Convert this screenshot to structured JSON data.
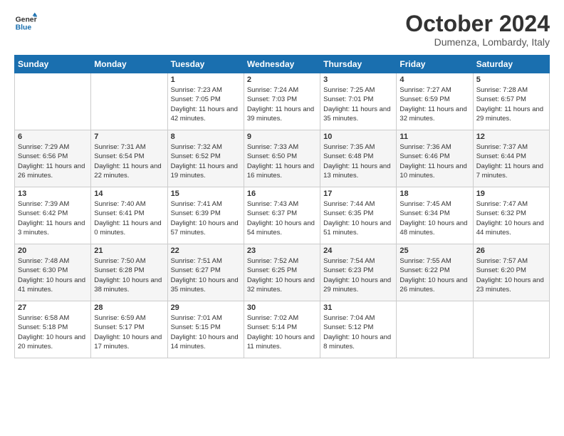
{
  "logo": {
    "line1": "General",
    "line2": "Blue"
  },
  "title": "October 2024",
  "subtitle": "Dumenza, Lombardy, Italy",
  "days_of_week": [
    "Sunday",
    "Monday",
    "Tuesday",
    "Wednesday",
    "Thursday",
    "Friday",
    "Saturday"
  ],
  "weeks": [
    [
      {
        "day": "",
        "info": ""
      },
      {
        "day": "",
        "info": ""
      },
      {
        "day": "1",
        "info": "Sunrise: 7:23 AM\nSunset: 7:05 PM\nDaylight: 11 hours and 42 minutes."
      },
      {
        "day": "2",
        "info": "Sunrise: 7:24 AM\nSunset: 7:03 PM\nDaylight: 11 hours and 39 minutes."
      },
      {
        "day": "3",
        "info": "Sunrise: 7:25 AM\nSunset: 7:01 PM\nDaylight: 11 hours and 35 minutes."
      },
      {
        "day": "4",
        "info": "Sunrise: 7:27 AM\nSunset: 6:59 PM\nDaylight: 11 hours and 32 minutes."
      },
      {
        "day": "5",
        "info": "Sunrise: 7:28 AM\nSunset: 6:57 PM\nDaylight: 11 hours and 29 minutes."
      }
    ],
    [
      {
        "day": "6",
        "info": "Sunrise: 7:29 AM\nSunset: 6:56 PM\nDaylight: 11 hours and 26 minutes."
      },
      {
        "day": "7",
        "info": "Sunrise: 7:31 AM\nSunset: 6:54 PM\nDaylight: 11 hours and 22 minutes."
      },
      {
        "day": "8",
        "info": "Sunrise: 7:32 AM\nSunset: 6:52 PM\nDaylight: 11 hours and 19 minutes."
      },
      {
        "day": "9",
        "info": "Sunrise: 7:33 AM\nSunset: 6:50 PM\nDaylight: 11 hours and 16 minutes."
      },
      {
        "day": "10",
        "info": "Sunrise: 7:35 AM\nSunset: 6:48 PM\nDaylight: 11 hours and 13 minutes."
      },
      {
        "day": "11",
        "info": "Sunrise: 7:36 AM\nSunset: 6:46 PM\nDaylight: 11 hours and 10 minutes."
      },
      {
        "day": "12",
        "info": "Sunrise: 7:37 AM\nSunset: 6:44 PM\nDaylight: 11 hours and 7 minutes."
      }
    ],
    [
      {
        "day": "13",
        "info": "Sunrise: 7:39 AM\nSunset: 6:42 PM\nDaylight: 11 hours and 3 minutes."
      },
      {
        "day": "14",
        "info": "Sunrise: 7:40 AM\nSunset: 6:41 PM\nDaylight: 11 hours and 0 minutes."
      },
      {
        "day": "15",
        "info": "Sunrise: 7:41 AM\nSunset: 6:39 PM\nDaylight: 10 hours and 57 minutes."
      },
      {
        "day": "16",
        "info": "Sunrise: 7:43 AM\nSunset: 6:37 PM\nDaylight: 10 hours and 54 minutes."
      },
      {
        "day": "17",
        "info": "Sunrise: 7:44 AM\nSunset: 6:35 PM\nDaylight: 10 hours and 51 minutes."
      },
      {
        "day": "18",
        "info": "Sunrise: 7:45 AM\nSunset: 6:34 PM\nDaylight: 10 hours and 48 minutes."
      },
      {
        "day": "19",
        "info": "Sunrise: 7:47 AM\nSunset: 6:32 PM\nDaylight: 10 hours and 44 minutes."
      }
    ],
    [
      {
        "day": "20",
        "info": "Sunrise: 7:48 AM\nSunset: 6:30 PM\nDaylight: 10 hours and 41 minutes."
      },
      {
        "day": "21",
        "info": "Sunrise: 7:50 AM\nSunset: 6:28 PM\nDaylight: 10 hours and 38 minutes."
      },
      {
        "day": "22",
        "info": "Sunrise: 7:51 AM\nSunset: 6:27 PM\nDaylight: 10 hours and 35 minutes."
      },
      {
        "day": "23",
        "info": "Sunrise: 7:52 AM\nSunset: 6:25 PM\nDaylight: 10 hours and 32 minutes."
      },
      {
        "day": "24",
        "info": "Sunrise: 7:54 AM\nSunset: 6:23 PM\nDaylight: 10 hours and 29 minutes."
      },
      {
        "day": "25",
        "info": "Sunrise: 7:55 AM\nSunset: 6:22 PM\nDaylight: 10 hours and 26 minutes."
      },
      {
        "day": "26",
        "info": "Sunrise: 7:57 AM\nSunset: 6:20 PM\nDaylight: 10 hours and 23 minutes."
      }
    ],
    [
      {
        "day": "27",
        "info": "Sunrise: 6:58 AM\nSunset: 5:18 PM\nDaylight: 10 hours and 20 minutes."
      },
      {
        "day": "28",
        "info": "Sunrise: 6:59 AM\nSunset: 5:17 PM\nDaylight: 10 hours and 17 minutes."
      },
      {
        "day": "29",
        "info": "Sunrise: 7:01 AM\nSunset: 5:15 PM\nDaylight: 10 hours and 14 minutes."
      },
      {
        "day": "30",
        "info": "Sunrise: 7:02 AM\nSunset: 5:14 PM\nDaylight: 10 hours and 11 minutes."
      },
      {
        "day": "31",
        "info": "Sunrise: 7:04 AM\nSunset: 5:12 PM\nDaylight: 10 hours and 8 minutes."
      },
      {
        "day": "",
        "info": ""
      },
      {
        "day": "",
        "info": ""
      }
    ]
  ]
}
